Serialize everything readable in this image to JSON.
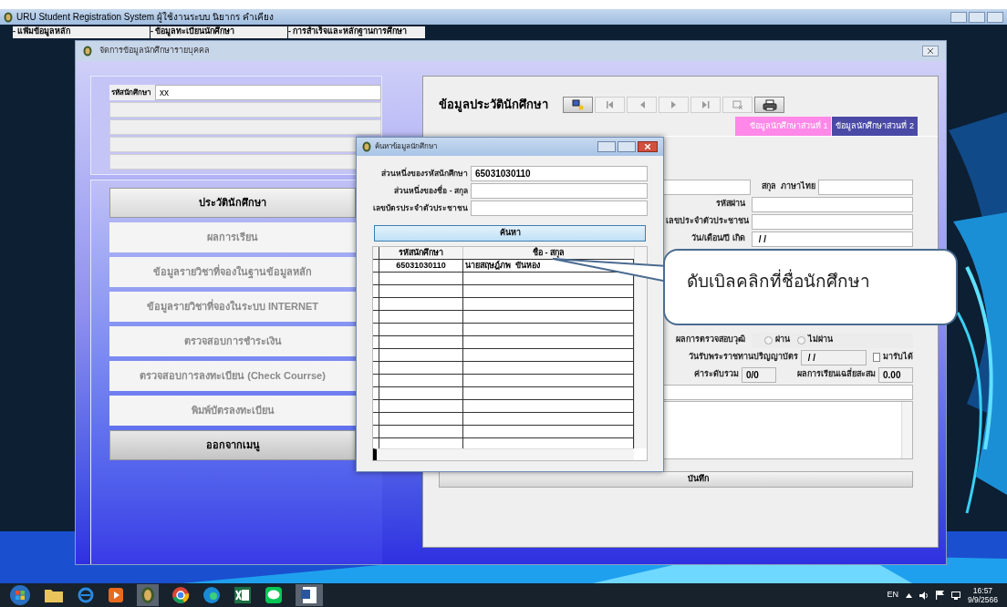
{
  "window": {
    "title": "URU Student Registration System ผู้ใช้งานระบบ นิยากร คำเคียง"
  },
  "menu": [
    "- แฟ้มข้อมูลหลัก",
    "- ข้อมูลทะเบียนนักศึกษา",
    "- การสำเร็จและหลักฐานการศึกษา"
  ],
  "inner_window": {
    "title": "จัดการข้อมูลนักศึกษารายบุคคล",
    "student_id": {
      "label": "รหัสนักศึกษา",
      "value": "xx"
    },
    "menu_buttons": [
      {
        "label": "ประวัตินักศึกษา",
        "selected": true
      },
      {
        "label": "ผลการเรียน",
        "selected": false
      },
      {
        "label": "ข้อมูลรายวิชาที่จองในฐานข้อมูลหลัก",
        "selected": false
      },
      {
        "label": "ข้อมูลรายวิชาที่จองในระบบ INTERNET",
        "selected": false
      },
      {
        "label": "ตรวจสอบการชำระเงิน",
        "selected": false
      },
      {
        "label": "ตรวจสอบการลงทะเบียน (Check Courrse)",
        "selected": false
      },
      {
        "label": "พิมพ์บัตรลงทะเบียน",
        "selected": false
      }
    ],
    "exit_button": "ออกจากเมนู",
    "profile": {
      "title": "ข้อมูลประวัตินักศึกษา",
      "toolbar": [
        {
          "kind": "browse",
          "disabled": false
        },
        {
          "kind": "first",
          "disabled": true
        },
        {
          "kind": "prev",
          "disabled": true
        },
        {
          "kind": "next",
          "disabled": true
        },
        {
          "kind": "last",
          "disabled": true
        },
        {
          "kind": "delete",
          "disabled": true
        },
        {
          "kind": "print",
          "disabled": false
        }
      ],
      "tabs": [
        {
          "label": "ข้อมูลนักศึกษาส่วนที่ 1",
          "selected": true
        },
        {
          "label": "ข้อมูลนักศึกษาส่วนที่ 2",
          "selected": false
        }
      ],
      "surname_label": "สกุล  ภาษาไทย",
      "password_label": "รหัสผ่าน",
      "id_card_label": "เลขประจำตัวประชาชน",
      "birth_date": {
        "label": "วัน/เดือน/ปี เกิด",
        "value": " / /"
      },
      "qualification": {
        "label": "ผลการตรวจสอบวุฒิ",
        "options": [
          {
            "label": "ผ่าน",
            "selected": false
          },
          {
            "label": "ไม่ผ่าน",
            "selected": false
          }
        ]
      },
      "graduation_date": {
        "label": "วันรับพระราชทานปริญญาบัตร",
        "value": " / /"
      },
      "attend_checkbox": {
        "label": "มารับได้",
        "checked": false
      },
      "grade_points": {
        "label": "ค่าระดับรวม",
        "value": "0/0"
      },
      "gpa": {
        "label": "ผลการเรียนเฉลี่ยสะสม",
        "value": "0.00"
      },
      "save_button": "บันทึก"
    }
  },
  "dialog": {
    "title": "ค้นหาข้อมูลนักศึกษา",
    "fields": [
      {
        "label": "ส่วนหนึ่งของรหัสนักศึกษา",
        "value": "65031030110"
      },
      {
        "label": "ส่วนหนึ่งของชื่อ - สกุล"
      },
      {
        "label": "เลขบัตรประจำตัวประชาชน"
      }
    ],
    "search_button": "ค้นหา",
    "table": {
      "columns": [
        "รหัสนักศึกษา",
        "ชื่อ - สกุล"
      ],
      "rows": [
        [
          "65031030110",
          "นายสฤษฎ์ภพ  ขันหอง"
        ]
      ]
    }
  },
  "callout": {
    "text": "ดับเบิลคลิกที่ชื่อนักศึกษา"
  },
  "taskbar": {
    "language": "EN",
    "time": "16:57",
    "date": "9/9/2566"
  }
}
